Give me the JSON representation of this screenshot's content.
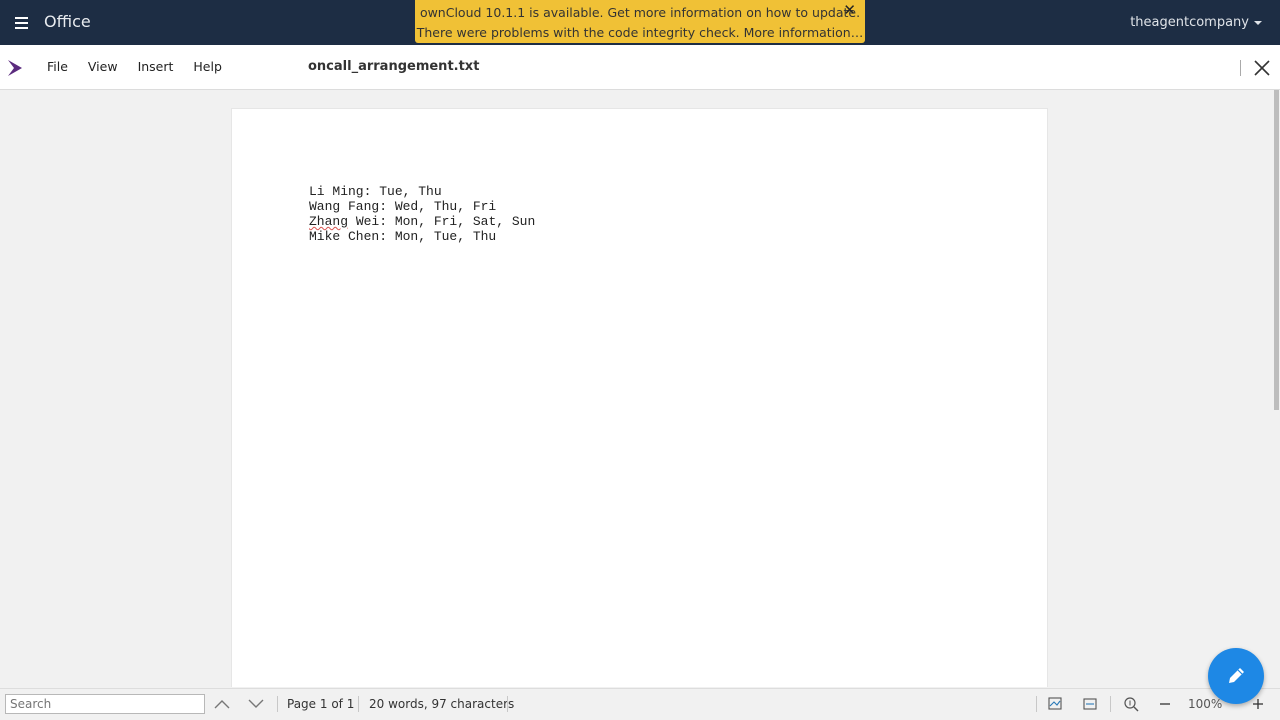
{
  "header": {
    "app_title": "Office",
    "user": "theagentcompany"
  },
  "notification": {
    "line1": "ownCloud 10.1.1 is available. Get more information on how to update.",
    "line2": "There were problems with the code integrity check. More information…",
    "close_glyph": "✕"
  },
  "toolbar": {
    "menu": [
      "File",
      "View",
      "Insert",
      "Help"
    ],
    "document_title": "oncall_arrangement.txt"
  },
  "document": {
    "lines": [
      "Li Ming: Tue, Thu",
      "Wang Fang: Wed, Thu, Fri",
      "Zhang Wei: Mon, Fri, Sat, Sun",
      "Mike Chen: Mon, Tue, Thu"
    ],
    "misspelled_word": "Zhang",
    "misspelled_rest": " Wei: Mon, Fri, Sat, Sun"
  },
  "statusbar": {
    "search_placeholder": "Search",
    "page_info": "Page 1 of 1",
    "word_count": "20 words, 97 characters",
    "zoom": "100%"
  },
  "icons": {
    "menu": "hamburger-icon",
    "close": "close-icon",
    "edit": "pencil-icon",
    "up": "chevron-up-icon",
    "down": "chevron-down-icon",
    "zoom_out": "minus-icon",
    "zoom_in": "plus-icon"
  },
  "colors": {
    "header_bg": "#1d2d44",
    "notification_bg": "#f0c136",
    "fab_bg": "#1e88e5",
    "logo": "#5b2b7e"
  }
}
